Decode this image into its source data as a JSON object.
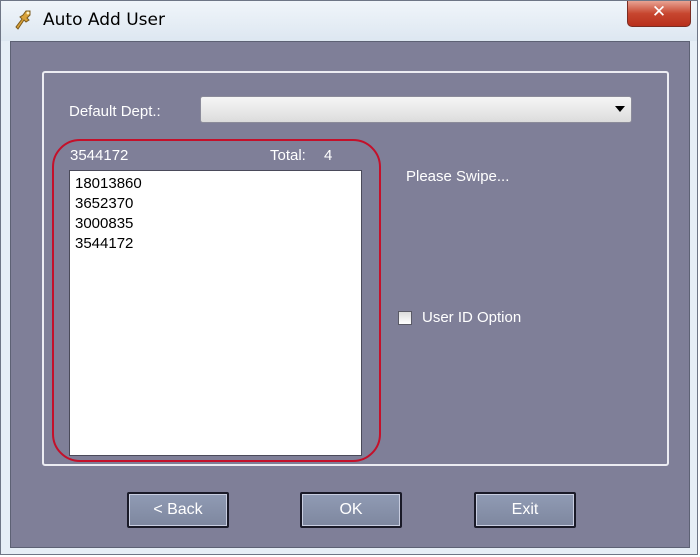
{
  "window": {
    "title": "Auto Add User",
    "close_glyph": "✕",
    "app_icon": "tools-icon"
  },
  "form": {
    "default_dept_label": "Default Dept.:",
    "default_dept_value": "",
    "current_id": "3544172",
    "total_label": "Total:",
    "total_value": "4",
    "swipe_prompt": "Please Swipe...",
    "user_id_option_label": "User ID Option",
    "user_id_option_checked": false
  },
  "user_list": [
    "18013860",
    "3652370",
    "3000835",
    "3544172"
  ],
  "buttons": {
    "back": "< Back",
    "ok": "OK",
    "exit": "Exit"
  },
  "colors": {
    "client_background": "#7f7f98",
    "highlight_ring": "#c4102a",
    "close_button": "#c7462f"
  }
}
